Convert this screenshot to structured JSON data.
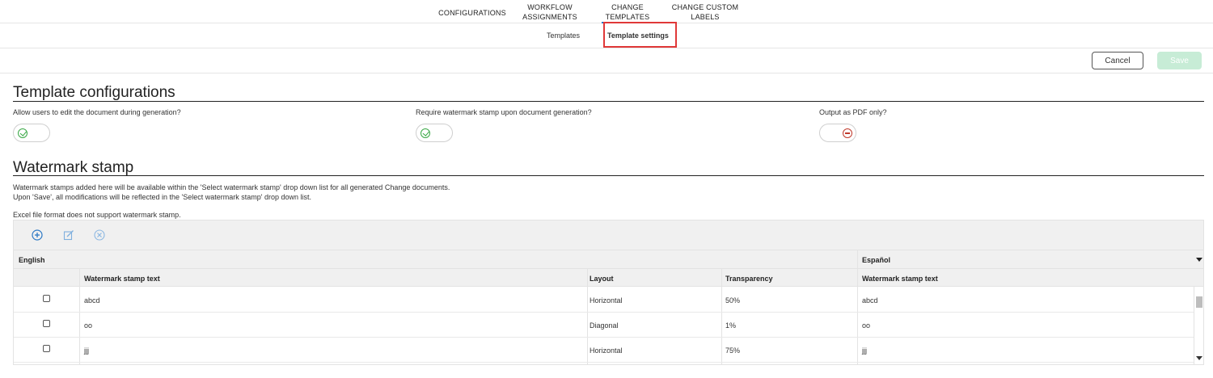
{
  "nav": {
    "tabs": [
      {
        "label": "CONFIGURATIONS"
      },
      {
        "label": "WORKFLOW\nASSIGNMENTS"
      },
      {
        "label": "CHANGE\nTEMPLATES"
      },
      {
        "label": "CHANGE CUSTOM\nLABELS"
      }
    ],
    "active_tab": "CHANGE TEMPLATES"
  },
  "subnav": {
    "templates_label": "Templates",
    "settings_label": "Template settings",
    "active": "Template settings",
    "highlight_color": "#e03838"
  },
  "actions": {
    "cancel_label": "Cancel",
    "save_label": "Save",
    "save_color": "#c7ecd6"
  },
  "config": {
    "title": "Template configurations",
    "options": [
      {
        "label": "Allow users to edit the document during generation?",
        "state": "on"
      },
      {
        "label": "Require watermark stamp upon document generation?",
        "state": "on"
      },
      {
        "label": "Output as PDF only?",
        "state": "off"
      }
    ]
  },
  "watermark": {
    "title": "Watermark stamp",
    "desc_line1": "Watermark stamps added here will be available within the 'Select watermark stamp' drop down list for all generated Change documents.",
    "desc_line2": "Upon 'Save', all modifications will be reflected in the 'Select watermark stamp' drop down list.",
    "note": "Excel file format does not support watermark stamp.",
    "toolbar": {
      "add_icon": "add-icon",
      "edit_icon": "edit-icon",
      "remove_icon": "remove-icon"
    },
    "groups": {
      "english": "English",
      "spanish": "Español"
    },
    "columns": {
      "text": "Watermark stamp text",
      "layout": "Layout",
      "transparency": "Transparency",
      "spanish_text": "Watermark stamp text"
    },
    "rows": [
      {
        "text": "abcd",
        "layout": "Horizontal",
        "transparency": "50%",
        "spanish_text": "abcd"
      },
      {
        "text": "oo",
        "layout": "Diagonal",
        "transparency": "1%",
        "spanish_text": "oo"
      },
      {
        "text": "jjj",
        "layout": "Horizontal",
        "transparency": "75%",
        "spanish_text": "jjj"
      }
    ]
  }
}
